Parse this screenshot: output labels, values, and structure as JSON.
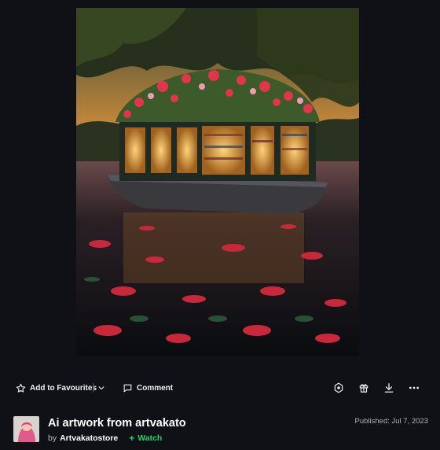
{
  "artwork": {
    "alt_icon": "houseboat-library-artwork"
  },
  "actions": {
    "favourite_label": "Add to Favourites",
    "comment_label": "Comment",
    "icons": [
      "star-icon",
      "chevron-down-icon",
      "comment-icon",
      "badge-icon",
      "gift-icon",
      "download-icon",
      "more-icon"
    ]
  },
  "deviation": {
    "title": "Ai artwork from artvakato",
    "by_label": "by",
    "author": "Artvakatostore",
    "watch_label": "Watch",
    "published": "Published: Jul 7, 2023"
  },
  "colors": {
    "background": "#0f1117",
    "watch_accent": "#23d160",
    "text": "#f2f2f2"
  }
}
